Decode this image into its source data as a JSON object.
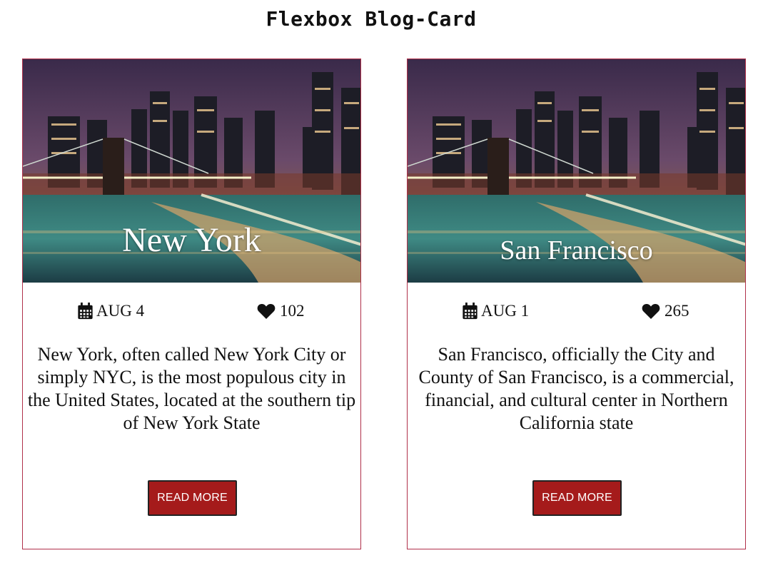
{
  "page": {
    "title": "Flexbox Blog-Card"
  },
  "cards": [
    {
      "city": "New York",
      "date": "AUG 4",
      "likes": "102",
      "description": "New York, often called New York City or simply NYC, is the most populous city in the United States, located at the southern tip of New York State",
      "button_label": "READ MORE",
      "date_icon": "calendar-icon",
      "likes_icon": "heart-icon"
    },
    {
      "city": "San Francisco",
      "date": "AUG 1",
      "likes": "265",
      "description": "San Francisco, officially the City and County of San Francisco, is a commercial, financial, and cultural center in Northern California state",
      "button_label": "READ MORE",
      "date_icon": "calendar-icon",
      "likes_icon": "heart-icon"
    }
  ],
  "colors": {
    "card_border": "#b0304a",
    "button_bg": "#a51b1b",
    "button_text": "#ffffff"
  }
}
